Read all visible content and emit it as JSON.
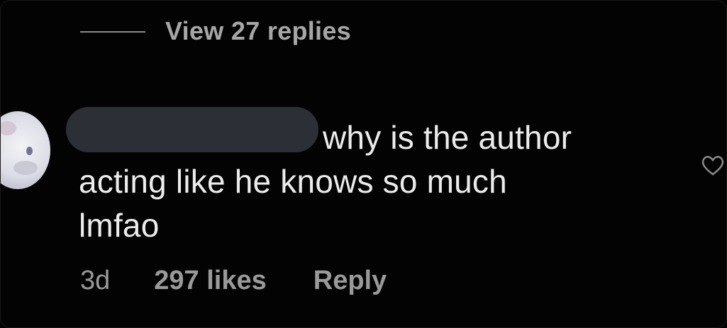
{
  "thread": {
    "view_replies_label": "View 27 replies"
  },
  "comment": {
    "text_line1": "why is the author",
    "text_line2": "acting like he knows so much",
    "text_line3": "lmfao",
    "time": "3d",
    "likes": "297 likes",
    "reply_label": "Reply"
  },
  "icons": {
    "avatar": "avatar-icon",
    "like": "heart-icon"
  },
  "colors": {
    "background": "#030303",
    "primary_text": "#ececec",
    "secondary_text": "#9a9a9a",
    "redaction": "#2d2f36"
  }
}
